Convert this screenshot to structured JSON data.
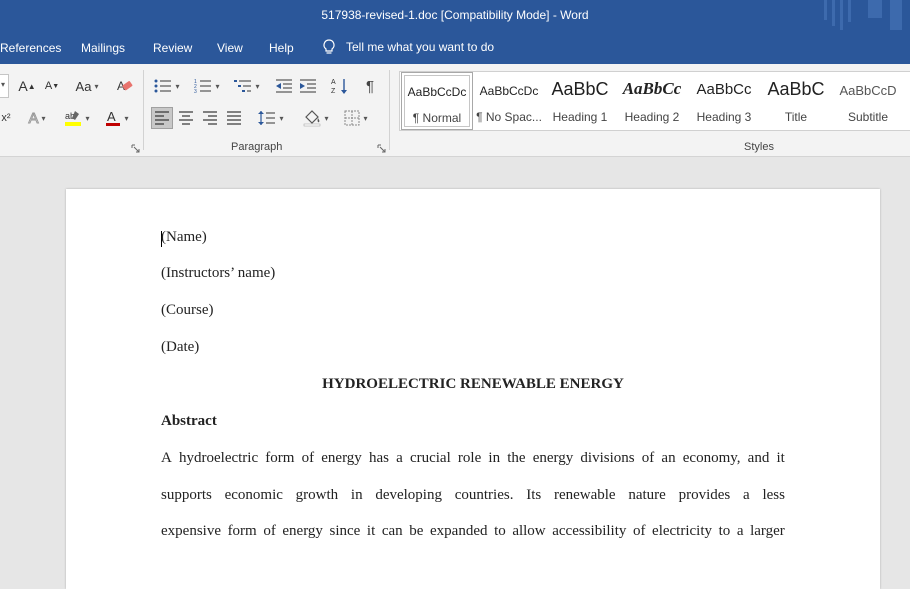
{
  "window": {
    "title": "517938-revised-1.doc [Compatibility Mode]  -  Word"
  },
  "tabs": [
    "References",
    "Mailings",
    "Review",
    "View",
    "Help"
  ],
  "tell_me": "Tell me what you want to do",
  "ribbon": {
    "paragraph_label": "Paragraph",
    "styles_label": "Styles",
    "font_case_label": "Aa",
    "grow_label": "A",
    "shrink_label": "A",
    "text_effects_label": "A",
    "superscript_label": "x²",
    "pilcrow_label": "¶"
  },
  "styles": [
    {
      "sample": "AaBbCcDc",
      "name": "¶ Normal"
    },
    {
      "sample": "AaBbCcDc",
      "name": "¶ No Spac..."
    },
    {
      "sample": "AaBbC",
      "name": "Heading 1"
    },
    {
      "sample": "AaBbCc",
      "name": "Heading 2"
    },
    {
      "sample": "AaBbCc",
      "name": "Heading 3"
    },
    {
      "sample": "AaBbC",
      "name": "Title"
    },
    {
      "sample": "AaBbCcD",
      "name": "Subtitle"
    }
  ],
  "document": {
    "name": "(Name)",
    "instructor": "(Instructors’ name)",
    "course": "(Course)",
    "date": "(Date)",
    "title": "HYDROELECTRIC RENEWABLE ENERGY",
    "abstract_heading": "Abstract",
    "paragraph_lines": [
      "A hydroelectric form of energy has a crucial role in the energy divisions of an economy, and it",
      "supports economic growth in developing countries. Its renewable nature provides a less",
      "expensive form of energy since it can be expanded to allow accessibility of electricity to a larger"
    ]
  },
  "colors": {
    "accent": "#2b579a",
    "font_color": "#c00000",
    "highlight": "#ffff00"
  }
}
